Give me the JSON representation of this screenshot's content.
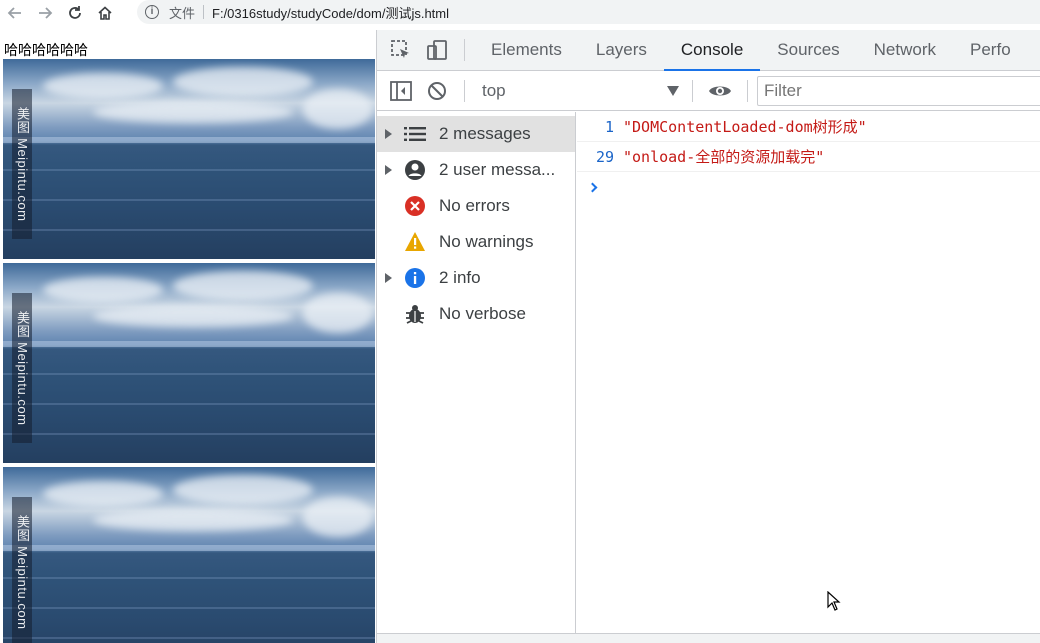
{
  "browser": {
    "scheme_label": "文件",
    "url": "F:/0316study/studyCode/dom/测试js.html",
    "nav_icons": [
      "back-arrow-icon",
      "forward-arrow-icon",
      "reload-icon",
      "home-icon"
    ]
  },
  "page": {
    "heading_text": "哈哈哈哈哈哈",
    "images": [
      {
        "watermark": "美图 Meipintu.com"
      },
      {
        "watermark": "美图 Meipintu.com"
      },
      {
        "watermark": "美图 Meipintu.com"
      }
    ]
  },
  "devtools": {
    "tabs": [
      {
        "label": "Elements",
        "active": false
      },
      {
        "label": "Layers",
        "active": false
      },
      {
        "label": "Console",
        "active": true
      },
      {
        "label": "Sources",
        "active": false
      },
      {
        "label": "Network",
        "active": false
      },
      {
        "label": "Perfo",
        "active": false
      }
    ],
    "toolbar": {
      "context": "top",
      "filter_placeholder": "Filter"
    },
    "sidebar": [
      {
        "label": "2 messages",
        "icon": "list-icon",
        "expandable": true,
        "selected": true
      },
      {
        "label": "2 user messa...",
        "icon": "user-icon",
        "expandable": true,
        "selected": false
      },
      {
        "label": "No errors",
        "icon": "error-icon",
        "expandable": false,
        "selected": false
      },
      {
        "label": "No warnings",
        "icon": "warning-icon",
        "expandable": false,
        "selected": false
      },
      {
        "label": "2 info",
        "icon": "info-icon",
        "expandable": true,
        "selected": false
      },
      {
        "label": "No verbose",
        "icon": "bug-icon",
        "expandable": false,
        "selected": false
      }
    ],
    "console_logs": [
      {
        "line": "1",
        "message": "\"DOMContentLoaded-dom树形成\""
      },
      {
        "line": "29",
        "message": "\"onload-全部的资源加载完\""
      }
    ],
    "colors": {
      "accent": "#1a73e8",
      "string": "#c41a16",
      "error": "#d93025",
      "warning": "#e8a600",
      "info": "#1a73e8"
    }
  }
}
